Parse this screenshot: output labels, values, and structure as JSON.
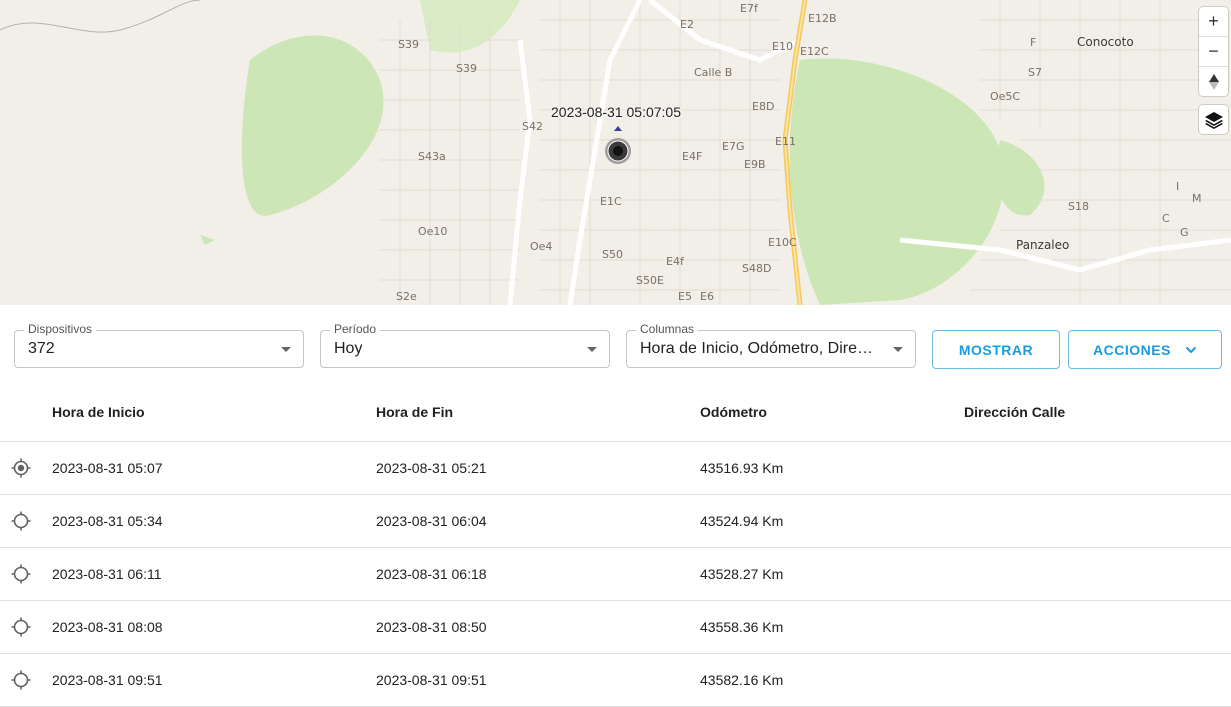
{
  "map": {
    "marker_time": "2023-08-31 05:07:05",
    "place_labels": [
      "Conocoto",
      "Panzaleo"
    ],
    "street_labels": [
      "S39",
      "S39",
      "S42",
      "S43a",
      "Oe10",
      "Oe4",
      "E1C",
      "S50",
      "S50E",
      "E4F",
      "E4f",
      "E5",
      "E6",
      "E7G",
      "E8D",
      "E9B",
      "E10",
      "E10C",
      "E11",
      "E12C",
      "E12B",
      "E7f",
      "E2",
      "Calle B",
      "S48D",
      "S7",
      "Oe5C",
      "S18",
      "F",
      "I",
      "M",
      "C",
      "G",
      "S2e"
    ],
    "controls": {
      "zoom_in": "+",
      "zoom_out": "−",
      "compass": "▲"
    }
  },
  "filters": {
    "devices": {
      "label": "Dispositivos",
      "value": "372"
    },
    "period": {
      "label": "Período",
      "value": "Hoy"
    },
    "columns": {
      "label": "Columnas",
      "value": "Hora de Inicio, Odómetro, Dirección Calle"
    },
    "show_button": "MOSTRAR",
    "actions_button": "ACCIONES"
  },
  "table": {
    "headers": [
      "Hora de Inicio",
      "Hora de Fin",
      "Odómetro",
      "Dirección Calle"
    ],
    "rows": [
      {
        "start": "2023-08-31 05:07",
        "end": "2023-08-31 05:21",
        "odometer": "43516.93 Km",
        "address": "",
        "selected": true
      },
      {
        "start": "2023-08-31 05:34",
        "end": "2023-08-31 06:04",
        "odometer": "43524.94 Km",
        "address": "",
        "selected": false
      },
      {
        "start": "2023-08-31 06:11",
        "end": "2023-08-31 06:18",
        "odometer": "43528.27 Km",
        "address": "",
        "selected": false
      },
      {
        "start": "2023-08-31 08:08",
        "end": "2023-08-31 08:50",
        "odometer": "43558.36 Km",
        "address": "",
        "selected": false
      },
      {
        "start": "2023-08-31 09:51",
        "end": "2023-08-31 09:51",
        "odometer": "43582.16 Km",
        "address": "",
        "selected": false
      }
    ]
  }
}
